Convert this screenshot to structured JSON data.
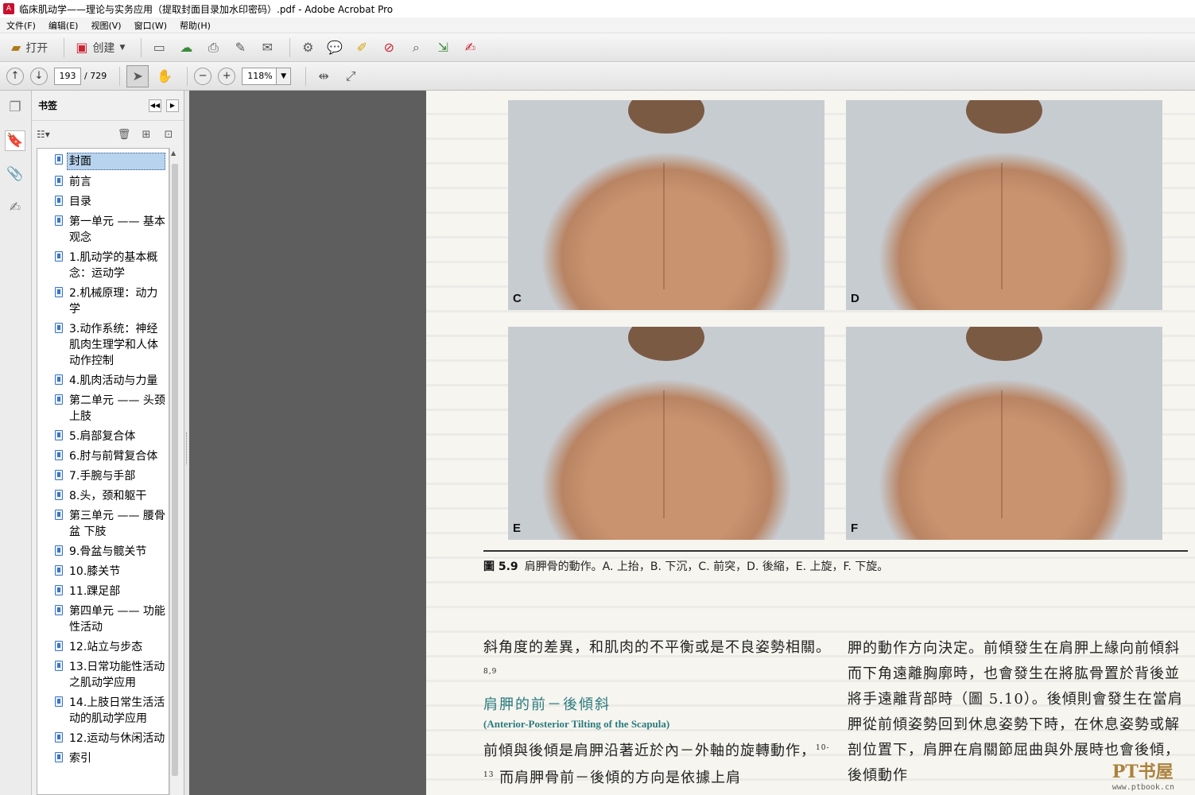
{
  "window": {
    "title": "临床肌动学——理论与实务应用（提取封面目录加水印密码）.pdf - Adobe Acrobat Pro"
  },
  "menu": {
    "items": [
      "文件(F)",
      "编辑(E)",
      "视图(V)",
      "窗口(W)",
      "帮助(H)"
    ]
  },
  "toolbar": {
    "open_label": "打开",
    "create_label": "创建"
  },
  "nav": {
    "current_page": "193",
    "page_count": "/ 729",
    "zoom": "118%"
  },
  "bookmarks": {
    "title": "书签",
    "items": [
      "封面",
      "前言",
      "目录",
      "第一单元 —— 基本观念",
      "1.肌动学的基本概念：运动学",
      "2.机械原理：动力学",
      "3.动作系统：神经肌肉生理学和人体动作控制",
      "4.肌肉活动与力量",
      "第二单元 —— 头颈上肢",
      "5.肩部复合体",
      "6.肘与前臂复合体",
      "7.手腕与手部",
      "8.头，颈和躯干",
      "第三单元 —— 腰骨盆 下肢",
      "9.骨盆与髋关节",
      "10.膝关节",
      "11.踝足部",
      "第四单元 —— 功能性活动",
      "12.站立与步态",
      "13.日常功能性活动之肌动学应用",
      "14.上肢日常生活活动的肌动学应用",
      "12.运动与休闲活动",
      "索引"
    ]
  },
  "page": {
    "photo_labels": [
      "C",
      "D",
      "E",
      "F"
    ],
    "caption_figno": "圖 5.9",
    "caption_text": "肩胛骨的動作。A. 上抬，B. 下沉，C. 前突，D. 後縮，E. 上旋，F. 下旋。",
    "left_p1": "斜角度的差異，和肌肉的不平衡或是不良姿勢相關。",
    "left_p1_sup": "8,9",
    "section_title": "肩胛的前－後傾斜",
    "section_sub": "(Anterior-Posterior Tilting of the Scapula)",
    "left_p2a": "前傾與後傾是肩胛沿著近於內－外軸的旋轉動作，",
    "left_p2_sup": "10-13",
    "left_p2b": " 而肩胛骨前－後傾的方向是依據上肩",
    "right_p": "胛的動作方向決定。前傾發生在肩胛上緣向前傾斜而下角遠離胸廓時，也會發生在將肱骨置於背後並將手遠離背部時（圖 5.10）。後傾則會發生在當肩胛從前傾姿勢回到休息姿勢下時，在休息姿勢或解剖位置下，肩胛在肩關節屈曲與外展時也會後傾，後傾動作",
    "watermark": "PT书屋",
    "watermark_url": "www.ptbook.cn"
  }
}
